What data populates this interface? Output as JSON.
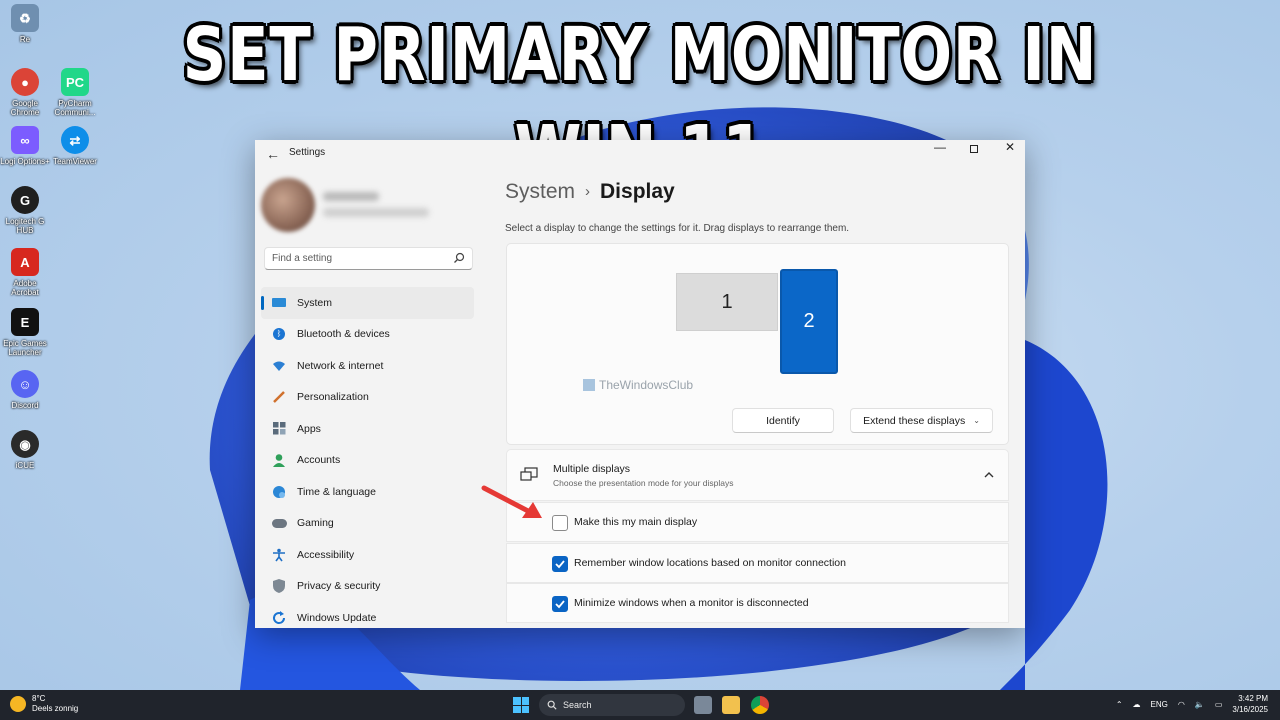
{
  "headline": "SET PRIMARY MONITOR IN WIN 11",
  "desktop_icons": [
    {
      "label": "Re",
      "icon": "recycle-bin-icon",
      "color": "#6f8fb0"
    },
    {
      "label": "Google Chrome",
      "icon": "chrome-icon",
      "color": "#db4437"
    },
    {
      "label": "PyCharm Communi...",
      "icon": "pycharm-icon",
      "color": "#21d789"
    },
    {
      "label": "Logi Options+",
      "icon": "logi-options-icon",
      "color": "#7c5cff"
    },
    {
      "label": "TeamViewer",
      "icon": "teamviewer-icon",
      "color": "#0e8ee9"
    },
    {
      "label": "Logitech G HUB",
      "icon": "logitech-ghub-icon",
      "color": "#1f1f1f"
    },
    {
      "label": "Adobe Acrobat",
      "icon": "acrobat-icon",
      "color": "#d7281f"
    },
    {
      "label": "Epic Games Launcher",
      "icon": "epic-games-icon",
      "color": "#111111"
    },
    {
      "label": "Discord",
      "icon": "discord-icon",
      "color": "#5865f2"
    },
    {
      "label": "iCUE",
      "icon": "icue-icon",
      "color": "#2a2a2a"
    }
  ],
  "window": {
    "title": "Settings",
    "search_placeholder": "Find a setting",
    "nav": [
      {
        "label": "System",
        "icon": "system-icon",
        "active": true
      },
      {
        "label": "Bluetooth & devices",
        "icon": "bluetooth-icon"
      },
      {
        "label": "Network & internet",
        "icon": "wifi-icon"
      },
      {
        "label": "Personalization",
        "icon": "brush-icon"
      },
      {
        "label": "Apps",
        "icon": "apps-icon"
      },
      {
        "label": "Accounts",
        "icon": "accounts-icon"
      },
      {
        "label": "Time & language",
        "icon": "globe-clock-icon"
      },
      {
        "label": "Gaming",
        "icon": "gamepad-icon"
      },
      {
        "label": "Accessibility",
        "icon": "accessibility-icon"
      },
      {
        "label": "Privacy & security",
        "icon": "shield-icon"
      },
      {
        "label": "Windows Update",
        "icon": "update-icon"
      }
    ]
  },
  "content": {
    "breadcrumb_parent": "System",
    "breadcrumb_sep": "›",
    "breadcrumb_current": "Display",
    "hint": "Select a display to change the settings for it. Drag displays to rearrange them.",
    "monitor_1": "1",
    "monitor_2": "2",
    "watermark": "TheWindowsClub",
    "identify_label": "Identify",
    "extend_label": "Extend these displays",
    "multiple_title": "Multiple displays",
    "multiple_sub": "Choose the presentation mode for your displays",
    "options": [
      {
        "label": "Make this my main display",
        "checked": false
      },
      {
        "label": "Remember window locations based on monitor connection",
        "checked": true
      },
      {
        "label": "Minimize windows when a monitor is disconnected",
        "checked": true
      }
    ]
  },
  "taskbar": {
    "temperature": "8°C",
    "weather": "Deels zonnig",
    "search_label": "Search",
    "language": "ENG",
    "time": "3:42 PM",
    "date": "3/16/2025"
  },
  "colors": {
    "accent": "#0067c0",
    "monitor_selected": "#0b67c8",
    "arrow": "#e53935"
  }
}
